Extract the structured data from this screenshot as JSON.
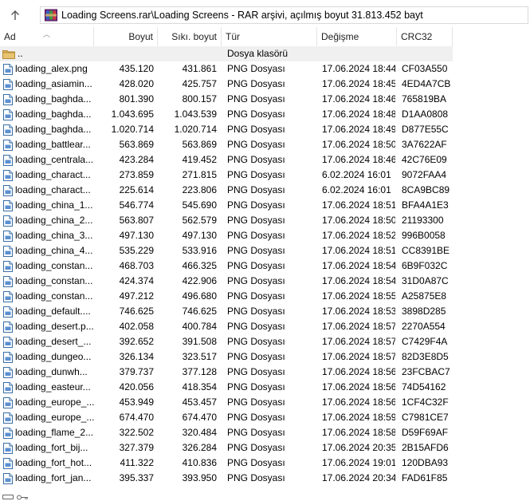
{
  "window": {
    "address": "Loading Screens.rar\\Loading Screens - RAR arşivi, açılmış boyut 31.813.452 bayt"
  },
  "columns": {
    "name": "Ad",
    "size": "Boyut",
    "packed": "Sıkı. boyut",
    "type": "Tür",
    "modified": "Değişme",
    "crc": "CRC32"
  },
  "parent_row": {
    "name": "..",
    "type": "Dosya klasörü"
  },
  "files": [
    {
      "name": "loading_alex.png",
      "size": "435.120",
      "packed": "431.861",
      "type": "PNG Dosyası",
      "modified": "17.06.2024 18:44",
      "crc": "CF03A550"
    },
    {
      "name": "loading_asiamin...",
      "size": "428.020",
      "packed": "425.757",
      "type": "PNG Dosyası",
      "modified": "17.06.2024 18:45",
      "crc": "4ED4A7CB"
    },
    {
      "name": "loading_baghda...",
      "size": "801.390",
      "packed": "800.157",
      "type": "PNG Dosyası",
      "modified": "17.06.2024 18:46",
      "crc": "765819BA"
    },
    {
      "name": "loading_baghda...",
      "size": "1.043.695",
      "packed": "1.043.539",
      "type": "PNG Dosyası",
      "modified": "17.06.2024 18:48",
      "crc": "D1AA0808"
    },
    {
      "name": "loading_baghda...",
      "size": "1.020.714",
      "packed": "1.020.714",
      "type": "PNG Dosyası",
      "modified": "17.06.2024 18:49",
      "crc": "D877E55C"
    },
    {
      "name": "loading_battlear...",
      "size": "563.869",
      "packed": "563.869",
      "type": "PNG Dosyası",
      "modified": "17.06.2024 18:50",
      "crc": "3A7622AF"
    },
    {
      "name": "loading_centrala...",
      "size": "423.284",
      "packed": "419.452",
      "type": "PNG Dosyası",
      "modified": "17.06.2024 18:46",
      "crc": "42C76E09"
    },
    {
      "name": "loading_charact...",
      "size": "273.859",
      "packed": "271.815",
      "type": "PNG Dosyası",
      "modified": "6.02.2024 16:01",
      "crc": "9072FAA4"
    },
    {
      "name": "loading_charact...",
      "size": "225.614",
      "packed": "223.806",
      "type": "PNG Dosyası",
      "modified": "6.02.2024 16:01",
      "crc": "8CA9BC89"
    },
    {
      "name": "loading_china_1...",
      "size": "546.774",
      "packed": "545.690",
      "type": "PNG Dosyası",
      "modified": "17.06.2024 18:51",
      "crc": "BFA4A1E3"
    },
    {
      "name": "loading_china_2...",
      "size": "563.807",
      "packed": "562.579",
      "type": "PNG Dosyası",
      "modified": "17.06.2024 18:50",
      "crc": "21193300"
    },
    {
      "name": "loading_china_3...",
      "size": "497.130",
      "packed": "497.130",
      "type": "PNG Dosyası",
      "modified": "17.06.2024 18:52",
      "crc": "996B0058"
    },
    {
      "name": "loading_china_4...",
      "size": "535.229",
      "packed": "533.916",
      "type": "PNG Dosyası",
      "modified": "17.06.2024 18:51",
      "crc": "CC8391BE"
    },
    {
      "name": "loading_constan...",
      "size": "468.703",
      "packed": "466.325",
      "type": "PNG Dosyası",
      "modified": "17.06.2024 18:54",
      "crc": "6B9F032C"
    },
    {
      "name": "loading_constan...",
      "size": "424.374",
      "packed": "422.906",
      "type": "PNG Dosyası",
      "modified": "17.06.2024 18:54",
      "crc": "31D0A87C"
    },
    {
      "name": "loading_constan...",
      "size": "497.212",
      "packed": "496.680",
      "type": "PNG Dosyası",
      "modified": "17.06.2024 18:55",
      "crc": "A25875E8"
    },
    {
      "name": "loading_default....",
      "size": "746.625",
      "packed": "746.625",
      "type": "PNG Dosyası",
      "modified": "17.06.2024 18:53",
      "crc": "3898D285"
    },
    {
      "name": "loading_desert.p...",
      "size": "402.058",
      "packed": "400.784",
      "type": "PNG Dosyası",
      "modified": "17.06.2024 18:57",
      "crc": "2270A554"
    },
    {
      "name": "loading_desert_...",
      "size": "392.652",
      "packed": "391.508",
      "type": "PNG Dosyası",
      "modified": "17.06.2024 18:57",
      "crc": "C7429F4A"
    },
    {
      "name": "loading_dungeo...",
      "size": "326.134",
      "packed": "323.517",
      "type": "PNG Dosyası",
      "modified": "17.06.2024 18:57",
      "crc": "82D3E8D5"
    },
    {
      "name": "loading_dunwh...",
      "size": "379.737",
      "packed": "377.128",
      "type": "PNG Dosyası",
      "modified": "17.06.2024 18:56",
      "crc": "23FCBAC7"
    },
    {
      "name": "loading_easteur...",
      "size": "420.056",
      "packed": "418.354",
      "type": "PNG Dosyası",
      "modified": "17.06.2024 18:56",
      "crc": "74D54162"
    },
    {
      "name": "loading_europe_...",
      "size": "453.949",
      "packed": "453.457",
      "type": "PNG Dosyası",
      "modified": "17.06.2024 18:56",
      "crc": "1CF4C32F"
    },
    {
      "name": "loading_europe_...",
      "size": "674.470",
      "packed": "674.470",
      "type": "PNG Dosyası",
      "modified": "17.06.2024 18:59",
      "crc": "C7981CE7"
    },
    {
      "name": "loading_flame_2...",
      "size": "322.502",
      "packed": "320.484",
      "type": "PNG Dosyası",
      "modified": "17.06.2024 18:58",
      "crc": "D59F69AF"
    },
    {
      "name": "loading_fort_bij...",
      "size": "327.379",
      "packed": "326.284",
      "type": "PNG Dosyası",
      "modified": "17.06.2024 20:35",
      "crc": "2B15AFD6"
    },
    {
      "name": "loading_fort_hot...",
      "size": "411.322",
      "packed": "410.836",
      "type": "PNG Dosyası",
      "modified": "17.06.2024 19:01",
      "crc": "120DBA93"
    },
    {
      "name": "loading_fort_jan...",
      "size": "395.337",
      "packed": "393.950",
      "type": "PNG Dosyası",
      "modified": "17.06.2024 20:34",
      "crc": "FAD61F85"
    }
  ],
  "icons": {
    "up": "arrow-up-icon",
    "archive": "rar-archive-icon",
    "folder": "folder-icon",
    "file": "png-file-icon"
  },
  "colors": {
    "parent_row_bg": "#f0f0f0",
    "folder": "#dcb35c",
    "file_icon_border": "#3a6ea5"
  }
}
